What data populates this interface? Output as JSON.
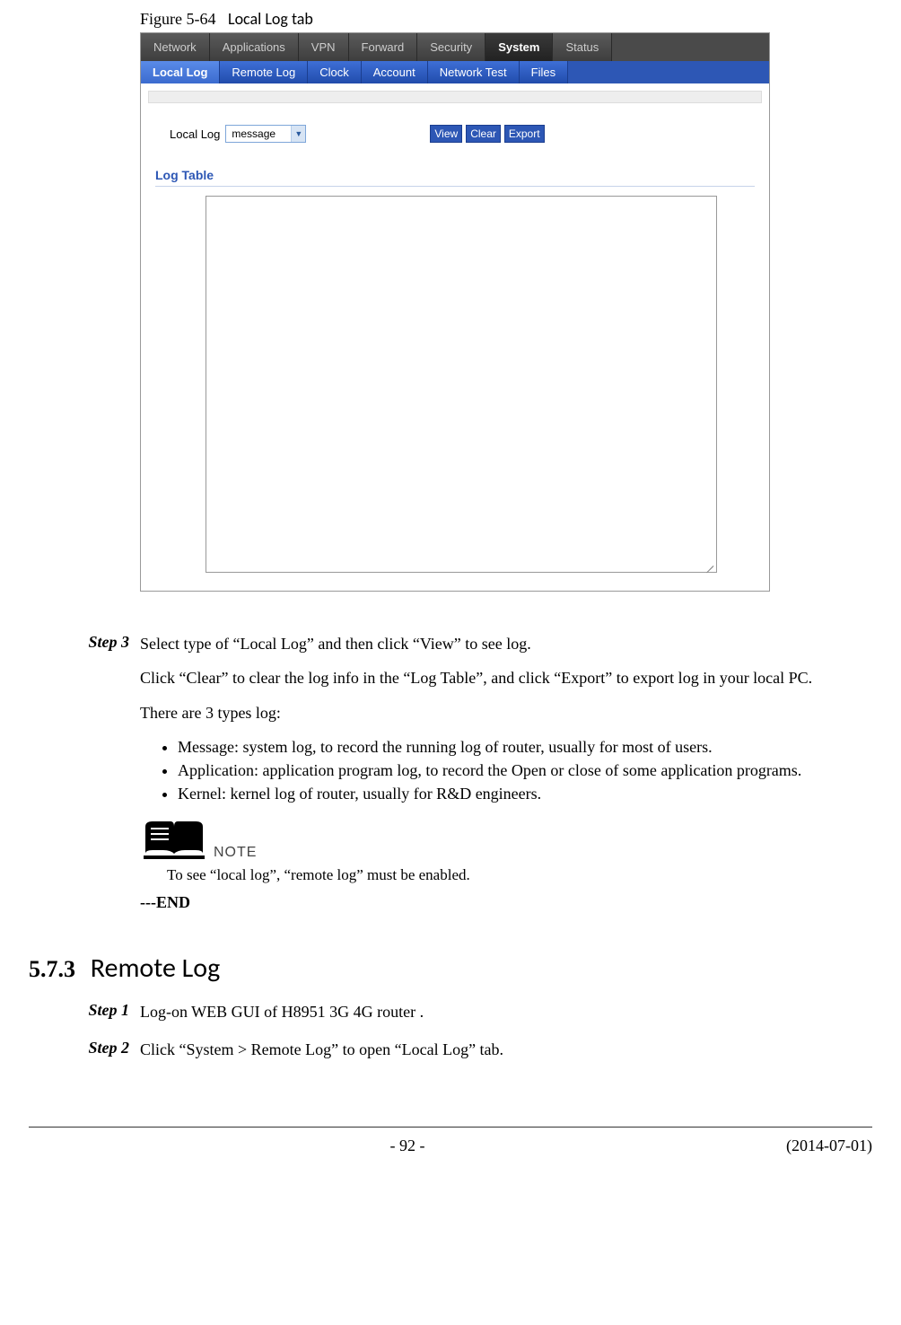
{
  "figure": {
    "num": "Figure 5-64",
    "title": "Local Log tab"
  },
  "screenshot": {
    "top_tabs": [
      "Network",
      "Applications",
      "VPN",
      "Forward",
      "Security",
      "System",
      "Status"
    ],
    "top_active_index": 5,
    "sub_tabs": [
      "Local Log",
      "Remote Log",
      "Clock",
      "Account",
      "Network Test",
      "Files"
    ],
    "sub_active_index": 0,
    "form": {
      "label": "Local Log",
      "select_value": "message",
      "buttons": [
        "View",
        "Clear",
        "Export"
      ]
    },
    "section_header": "Log Table"
  },
  "step3": {
    "label": "Step 3",
    "p1": "Select type of “Local Log” and then click “View” to see log.",
    "p2": "Click “Clear” to clear the log info in the “Log Table”, and click “Export” to export log in your local PC.",
    "p3": "There are 3 types log:",
    "bullets": [
      "Message: system log, to record the running log of router, usually for most of users.",
      "Application: application program log, to record the Open or close of some application programs.",
      "Kernel: kernel log of router, usually for R&D engineers."
    ],
    "note_word": "NOTE",
    "note_text": "To see “local log”, “remote log” must be enabled.",
    "end": "---END"
  },
  "remote": {
    "number": "5.7.3",
    "title": "Remote Log",
    "step1": {
      "label": "Step 1",
      "text": "Log-on WEB GUI of H8951 3G 4G router ."
    },
    "step2": {
      "label": "Step 2",
      "text": "Click “System > Remote Log” to open “Local Log” tab."
    }
  },
  "footer": {
    "page": "- 92 -",
    "date": "(2014-07-01)"
  }
}
